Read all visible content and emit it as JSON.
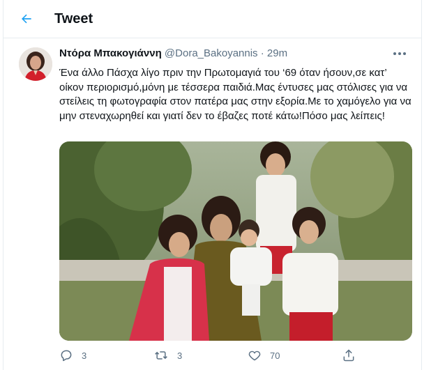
{
  "header": {
    "title": "Tweet",
    "back_icon": "arrow-left-icon"
  },
  "tweet": {
    "author_name": "Ντόρα Μπακογιάννη",
    "handle": "@Dora_Bakoyannis",
    "separator": "·",
    "time": "29m",
    "more_icon": "more-dots-icon",
    "text": "Ένα άλλο Πάσχα λίγο πριν την Πρωτομαγιά του ‘69 όταν ήσουν,σε κατ’ οίκον περιορισμό,μόνη με τέσσερα παιδιά.Μας έντυσες μας στόλισες για να στείλεις τη φωτογραφία στον πατέρα μας στην εξορία.Με το χαμόγελο για να μην στεναχωρηθεί και γιατί δεν το έβαζες ποτέ κάτω!Πόσο μας λείπεις!"
  },
  "actions": {
    "reply": {
      "icon": "reply-icon",
      "count": "3"
    },
    "retweet": {
      "icon": "retweet-icon",
      "count": "3"
    },
    "like": {
      "icon": "heart-icon",
      "count": "70"
    },
    "share": {
      "icon": "share-icon"
    }
  },
  "colors": {
    "accent": "#1da1f2",
    "muted": "#5b7083",
    "border": "#e6ecf0"
  }
}
